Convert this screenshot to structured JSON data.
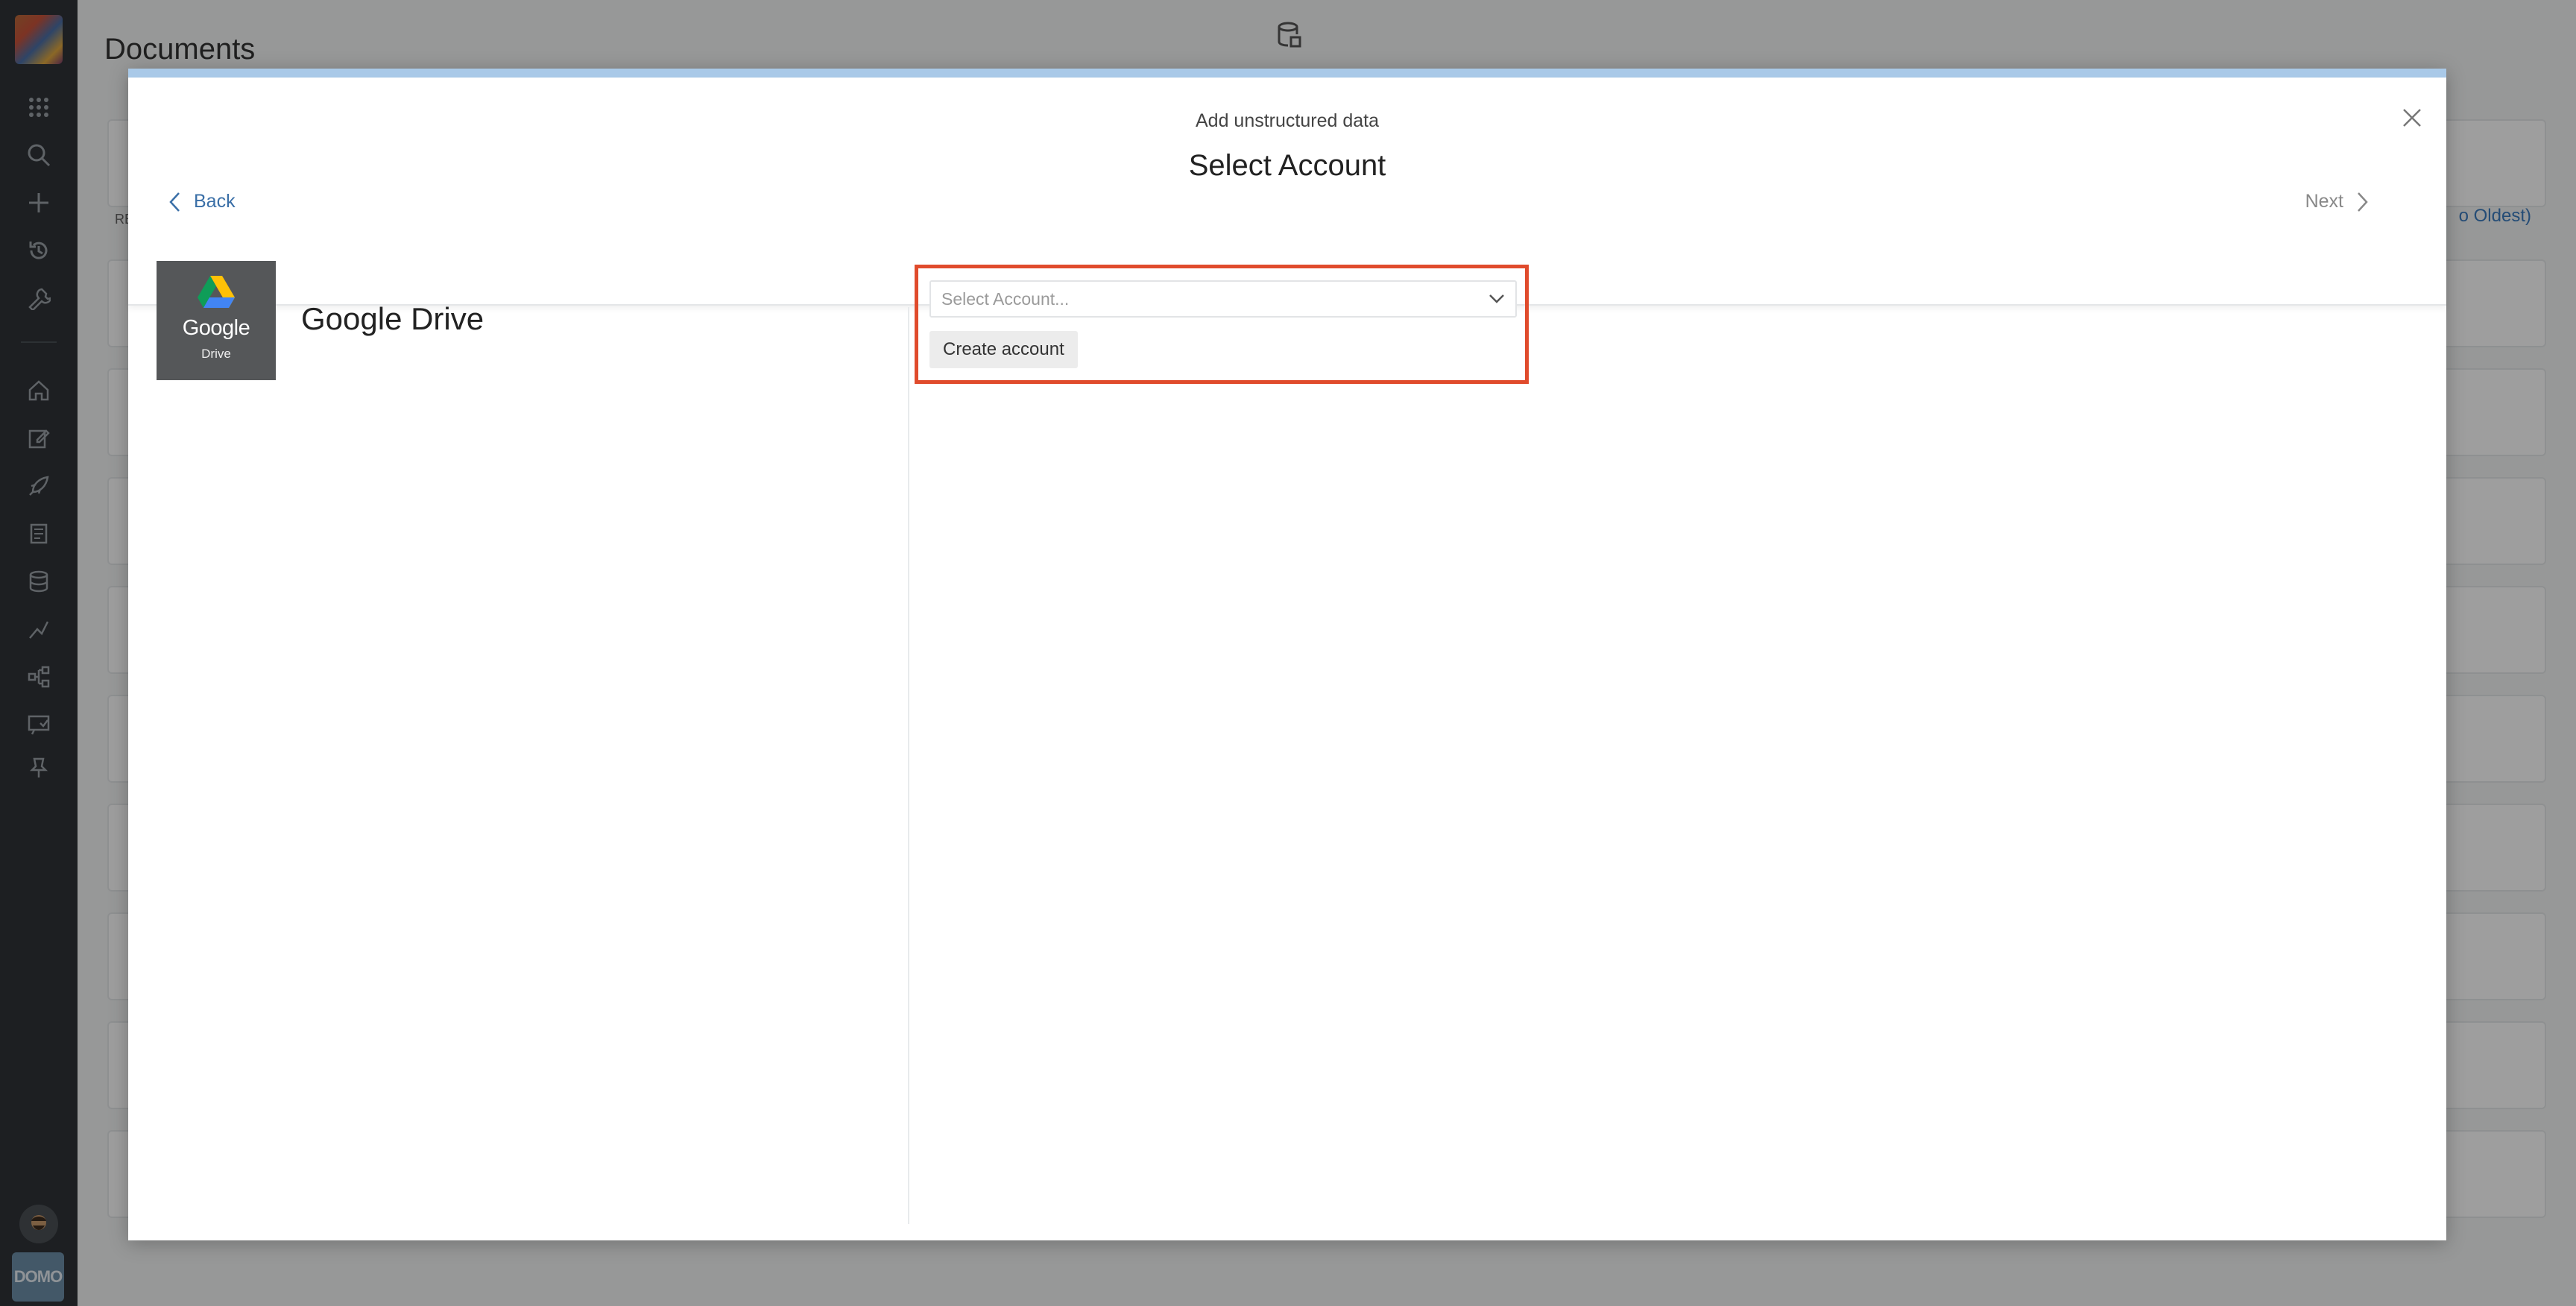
{
  "page": {
    "title": "Documents",
    "sort_label": "o Oldest)",
    "re_label": "RE"
  },
  "modal": {
    "subtitle": "Add unstructured data",
    "heading": "Select Account",
    "back_label": "Back",
    "next_label": "Next"
  },
  "connector": {
    "logo_word": "Google",
    "logo_sub": "Drive",
    "name": "Google Drive"
  },
  "account": {
    "select_placeholder": "Select Account...",
    "create_label": "Create account"
  },
  "rail": {
    "brand": "DOMO"
  },
  "colors": {
    "highlight": "#e04b2c",
    "link": "#3a6fa7",
    "modal_topbar": "#a9c9e8"
  }
}
